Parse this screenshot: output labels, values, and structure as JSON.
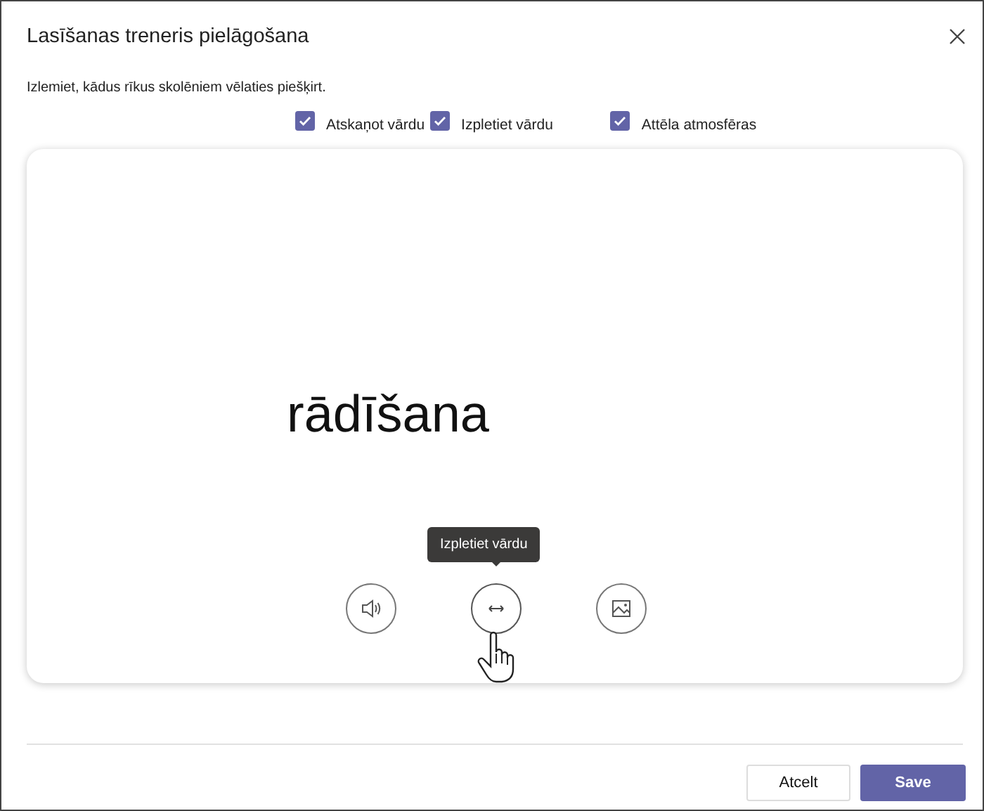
{
  "window": {
    "title": "Lasīšanas treneris pielāgošana"
  },
  "instruction": "Izlemiet, kādus rīkus skolēniem vēlaties piešķirt.",
  "tools": [
    {
      "label": "Atskaņot vārdu",
      "checked": true
    },
    {
      "label": "Izpletiet vārdu",
      "checked": true
    },
    {
      "label": "Attēla atmosfēras",
      "checked": true
    }
  ],
  "preview": {
    "word": "rādīšana",
    "tooltip": "Izpletiet vārdu",
    "buttons": [
      {
        "kind": "speaker",
        "hovered": false
      },
      {
        "kind": "expand",
        "hovered": true
      },
      {
        "kind": "image",
        "hovered": false
      }
    ]
  },
  "buttons": [
    {
      "label": "Atcelt",
      "kind": "secondary"
    },
    {
      "label": "Save",
      "kind": "primary"
    }
  ]
}
